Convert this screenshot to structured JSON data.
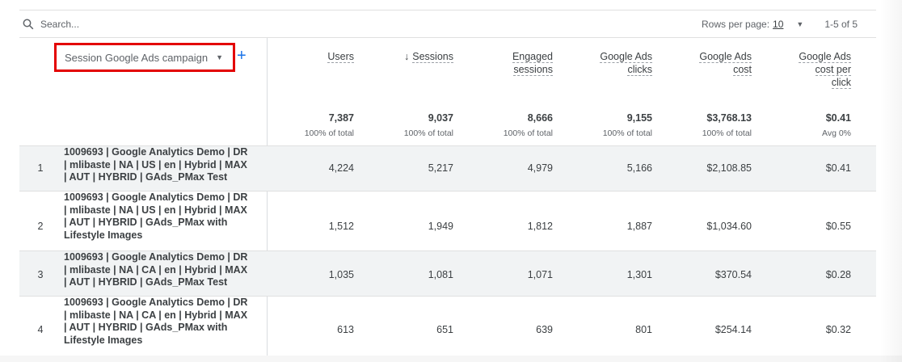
{
  "search": {
    "placeholder": "Search..."
  },
  "pagination": {
    "rows_per_page_label": "Rows per page:",
    "rows_per_page_value": "10",
    "range_label": "1-5 of 5"
  },
  "dimension": {
    "label": "Session Google Ads campaign",
    "add_label": "+"
  },
  "columns": {
    "users": {
      "label": "Users",
      "total": "7,387",
      "pct": "100% of total"
    },
    "sessions": {
      "arrow": "↓",
      "label": "Sessions",
      "total": "9,037",
      "pct": "100% of total"
    },
    "engaged": {
      "line1": "Engaged",
      "line2": "sessions",
      "total": "8,666",
      "pct": "100% of total"
    },
    "clicks": {
      "line1": "Google Ads",
      "line2": "clicks",
      "total": "9,155",
      "pct": "100% of total"
    },
    "cost": {
      "line1": "Google Ads",
      "line2": "cost",
      "total": "$3,768.13",
      "pct": "100% of total"
    },
    "cpc": {
      "line1": "Google Ads",
      "line2": "cost per",
      "line3": "click",
      "total": "$0.41",
      "pct": "Avg 0%"
    }
  },
  "rows": [
    {
      "index": "1",
      "campaign": [
        "1009693 | Google Analytics Demo | DR",
        "| mlibaste | NA | US | en | Hybrid | MAX",
        "| AUT | HYBRID | GAds_PMax Test"
      ],
      "users": "4,224",
      "sessions": "5,217",
      "engaged": "4,979",
      "clicks": "5,166",
      "cost": "$2,108.85",
      "cpc": "$0.41"
    },
    {
      "index": "2",
      "campaign": [
        "1009693 | Google Analytics Demo | DR",
        "| mlibaste | NA | US | en | Hybrid | MAX",
        "| AUT | HYBRID | GAds_PMax with",
        "Lifestyle Images"
      ],
      "users": "1,512",
      "sessions": "1,949",
      "engaged": "1,812",
      "clicks": "1,887",
      "cost": "$1,034.60",
      "cpc": "$0.55"
    },
    {
      "index": "3",
      "campaign": [
        "1009693 | Google Analytics Demo | DR",
        "| mlibaste | NA | CA | en | Hybrid | MAX",
        "| AUT | HYBRID | GAds_PMax Test"
      ],
      "users": "1,035",
      "sessions": "1,081",
      "engaged": "1,071",
      "clicks": "1,301",
      "cost": "$370.54",
      "cpc": "$0.28"
    },
    {
      "index": "4",
      "campaign": [
        "1009693 | Google Analytics Demo | DR",
        "| mlibaste | NA | CA | en | Hybrid | MAX",
        "| AUT | HYBRID | GAds_PMax with",
        "Lifestyle Images"
      ],
      "users": "613",
      "sessions": "651",
      "engaged": "639",
      "clicks": "801",
      "cost": "$254.14",
      "cpc": "$0.32"
    }
  ]
}
